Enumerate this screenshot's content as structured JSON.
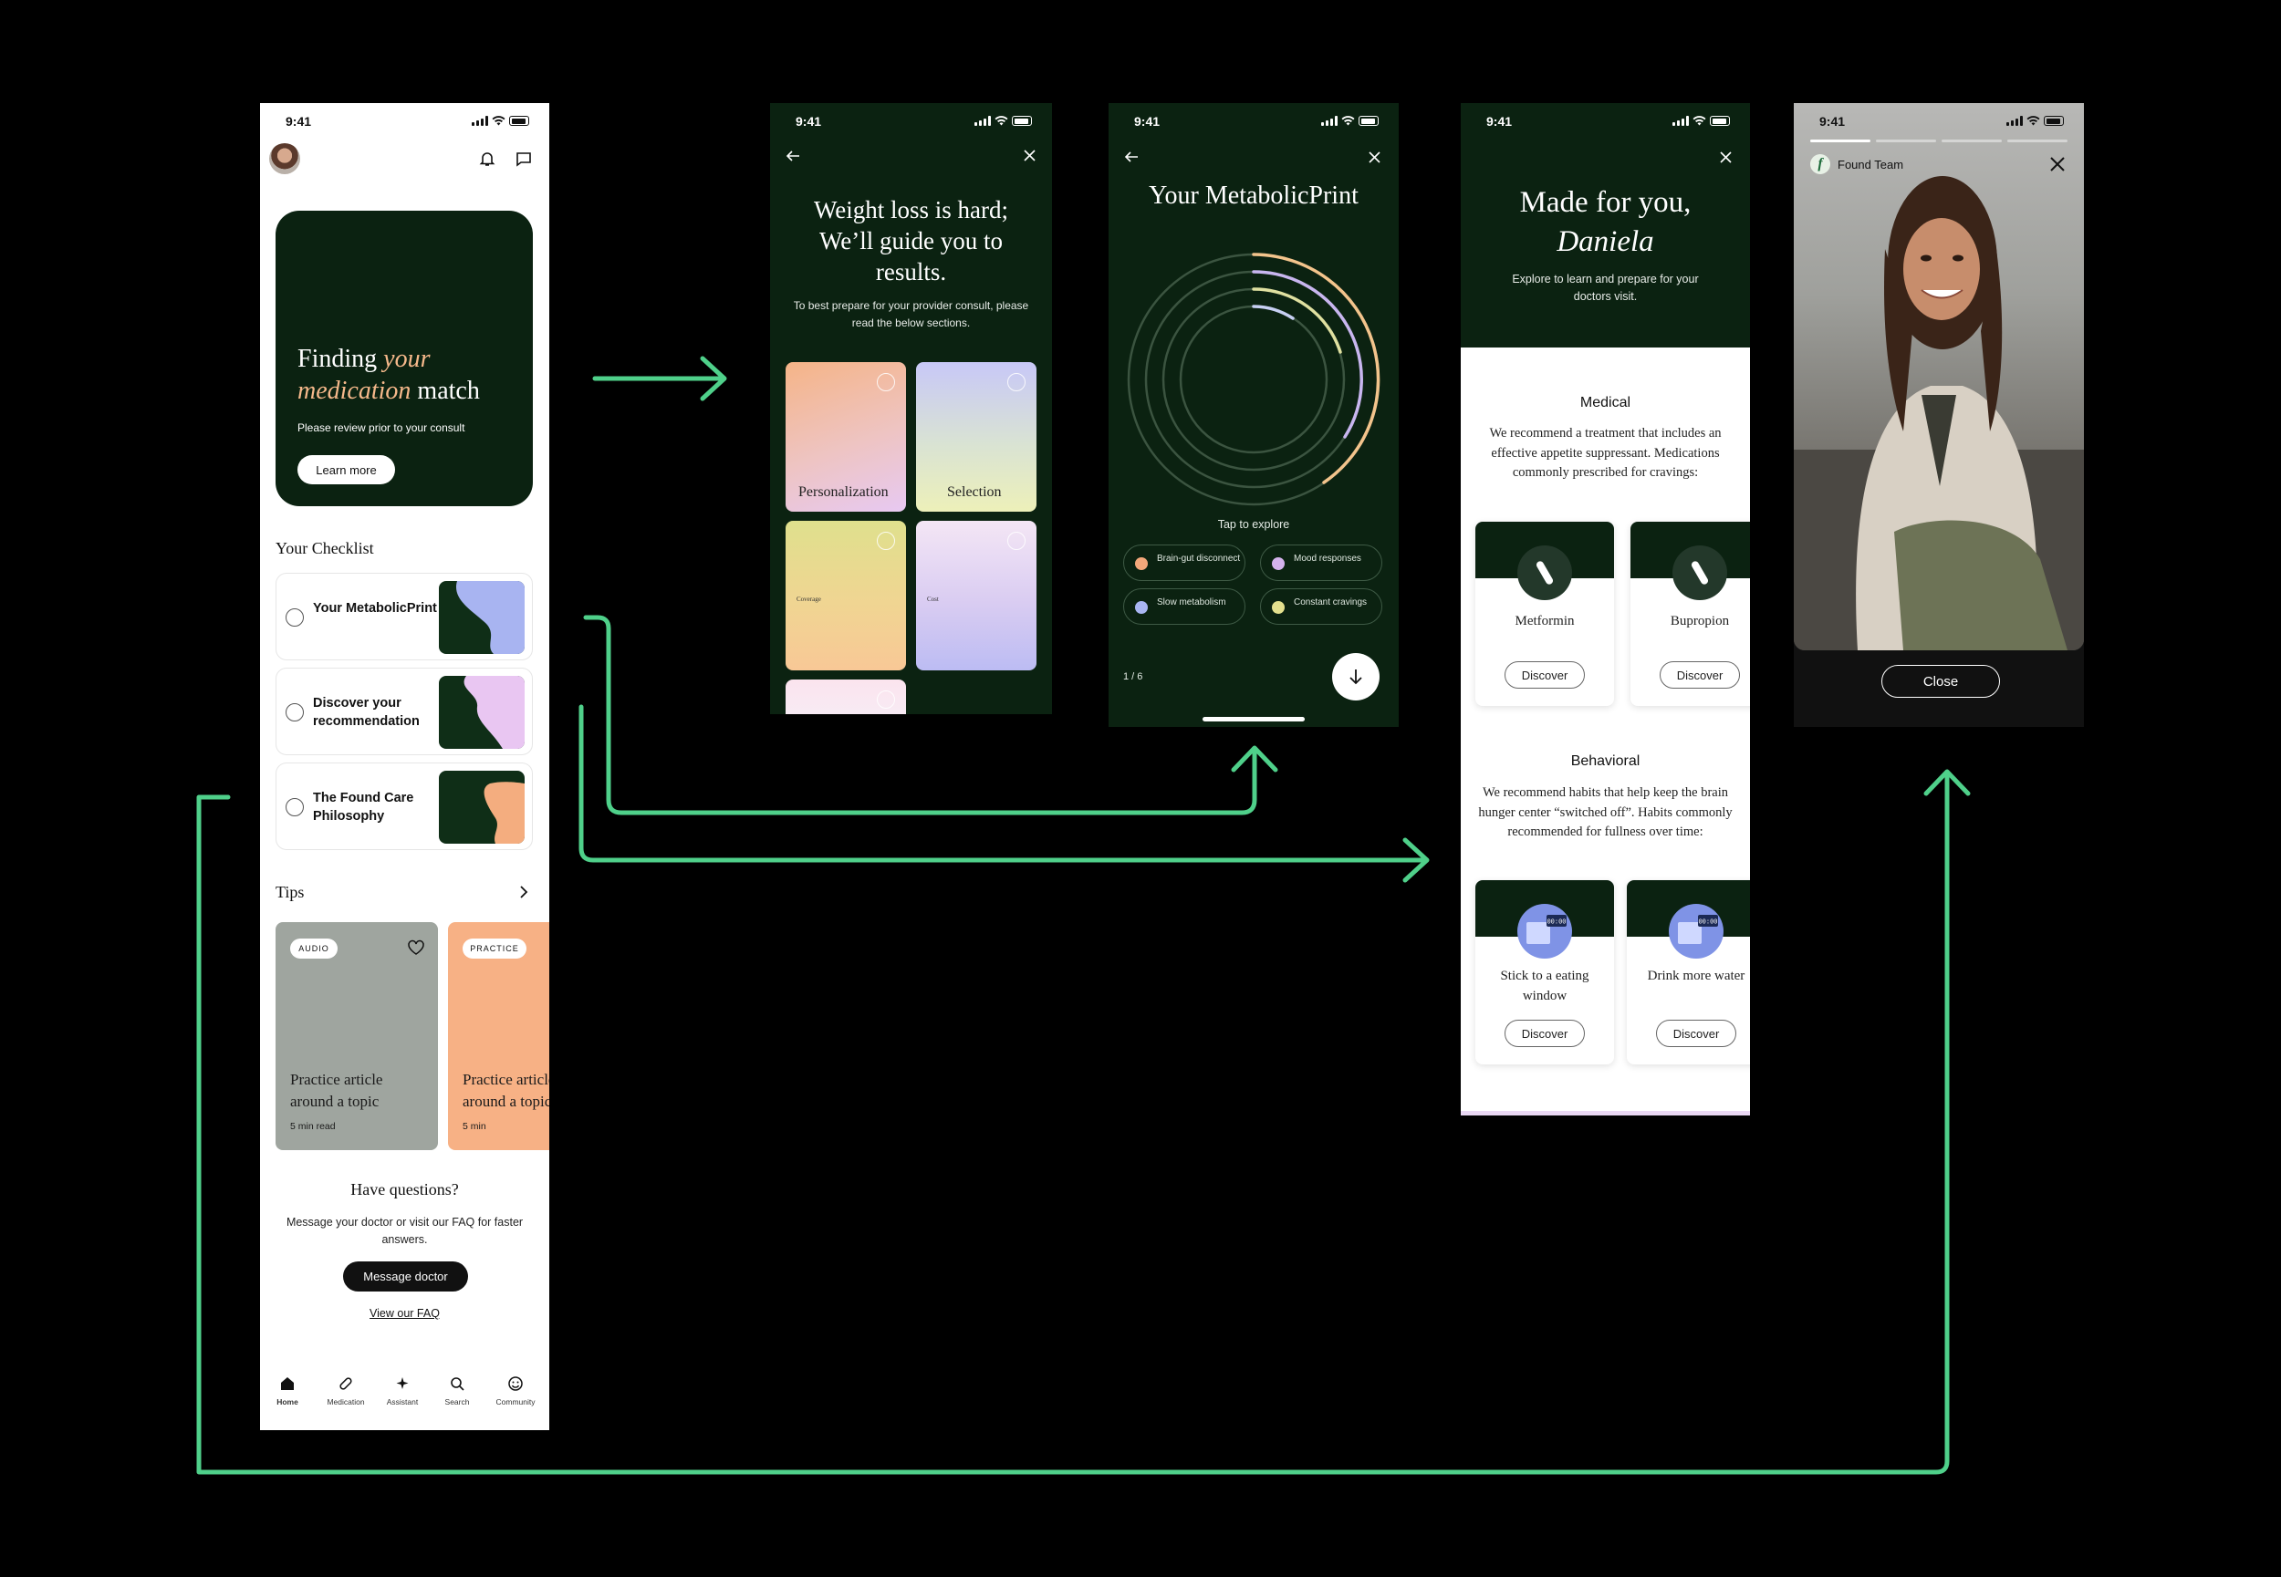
{
  "status_time": "9:41",
  "home": {
    "hero": {
      "title_1": "Finding",
      "title_2": "your",
      "title_3": "medication",
      "title_4": "match",
      "subtitle": "Please review prior to your consult",
      "button": "Learn more"
    },
    "checklist_title": "Your Checklist",
    "checklist": [
      {
        "label": "Your MetabolicPrint"
      },
      {
        "label": "Discover your recommendation"
      },
      {
        "label": "The Found Care Philosophy"
      }
    ],
    "tips_title": "Tips",
    "tips": [
      {
        "badge": "AUDIO",
        "title": "Practice article around a topic",
        "meta": "5 min read"
      },
      {
        "badge": "PRACTICE",
        "title": "Practice article around a topic",
        "meta": "5 min"
      }
    ],
    "questions_title": "Have questions?",
    "questions_body": "Message your doctor or visit our FAQ for faster answers.",
    "message_button": "Message doctor",
    "faq_link": "View our FAQ",
    "tabs": [
      "Home",
      "Medication",
      "Assistant",
      "Search",
      "Community"
    ]
  },
  "guide": {
    "title": "Weight loss is hard; We’ll guide you to results.",
    "subtitle": "To best prepare for your provider consult, please read the below sections.",
    "tiles": [
      "Personalization",
      "Selection",
      "Coverage",
      "Cost"
    ]
  },
  "metabolic": {
    "title": "Your MetabolicPrint",
    "tap": "Tap to explore",
    "legend": [
      "Brain-gut disconnect",
      "Mood responses",
      "Slow metabolism",
      "Constant cravings"
    ],
    "pager": "1 / 6",
    "colors": {
      "orange": "#f3a77a",
      "purple": "#d4b2ec",
      "blue": "#a9b6f2",
      "yellow": "#e3e08e"
    }
  },
  "made": {
    "title_1": "Made for you,",
    "title_2": "Daniela",
    "subtitle": "Explore to learn and  prepare for your doctors visit.",
    "medical_title": "Medical",
    "medical_body": "We recommend a treatment that includes an effective appetite suppressant. Medications commonly prescribed for cravings:",
    "medical_cards": [
      "Metformin",
      "Bupropion"
    ],
    "behavioral_title": "Behavioral",
    "behavioral_body": "We recommend habits that help keep the brain hunger center “switched off”. Habits commonly recommended for fullness over time:",
    "behavioral_cards": [
      "Stick to a eating window",
      "Drink more water"
    ],
    "discover": "Discover",
    "clock_text": "00:00"
  },
  "video": {
    "sender": "Found Team",
    "close": "Close"
  }
}
